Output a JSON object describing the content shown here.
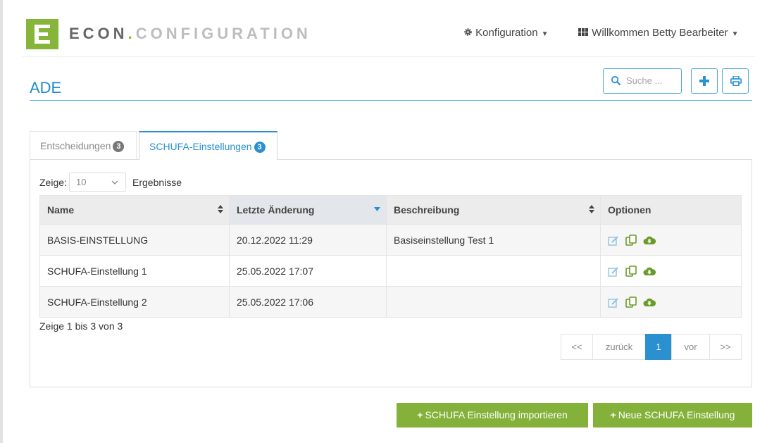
{
  "brand": {
    "part1": "ECON",
    "dot": ".",
    "part2": "CONFIGURATION"
  },
  "nav": {
    "config_label": "Konfiguration",
    "user_label": "Willkommen Betty Bearbeiter"
  },
  "page": {
    "title": "ADE"
  },
  "search": {
    "placeholder": "Suche ..."
  },
  "tabs": [
    {
      "label": "Entscheidungen",
      "badge": "3"
    },
    {
      "label": "SCHUFA-Einstellungen",
      "badge": "3"
    }
  ],
  "length": {
    "prefix": "Zeige:",
    "value": "10",
    "suffix": "Ergebnisse"
  },
  "table": {
    "columns": [
      "Name",
      "Letzte Änderung",
      "Beschreibung",
      "Optionen"
    ],
    "rows": [
      {
        "name": "BASIS-EINSTELLUNG",
        "date": "20.12.2022 11:29",
        "desc": "Basiseinstellung Test 1"
      },
      {
        "name": "SCHUFA-Einstellung 1",
        "date": "25.05.2022 17:07",
        "desc": ""
      },
      {
        "name": "SCHUFA-Einstellung 2",
        "date": "25.05.2022 17:06",
        "desc": ""
      }
    ]
  },
  "info": "Zeige 1 bis 3 von 3",
  "pagination": {
    "first": "<<",
    "prev": "zurück",
    "current": "1",
    "next": "vor",
    "last": ">>"
  },
  "actions": {
    "import_label": "SCHUFA Einstellung importieren",
    "new_label": "Neue SCHUFA Einstellung",
    "plus": "+"
  },
  "colors": {
    "brand_green": "#86b539",
    "accent_blue": "#2a90cf",
    "button_green": "#84b13a"
  }
}
